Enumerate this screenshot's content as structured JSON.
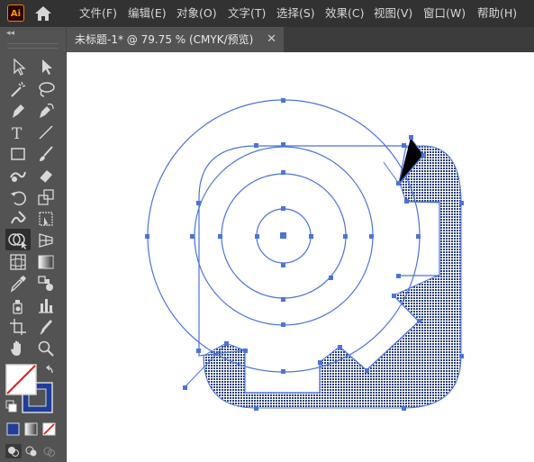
{
  "app": {
    "logo": "Ai"
  },
  "menus": [
    "文件(F)",
    "编辑(E)",
    "对象(O)",
    "文字(T)",
    "选择(S)",
    "效果(C)",
    "视图(V)",
    "窗口(W)",
    "帮助(H)"
  ],
  "document_tab": {
    "title": "未标题-1* @ 79.75 % (CMYK/预览)",
    "close": "✕"
  },
  "toolbar": {
    "collapse": "◂◂",
    "tools": [
      "selection-tool",
      "direct-selection-tool",
      "magic-wand-tool",
      "lasso-tool",
      "pen-tool",
      "curvature-tool",
      "type-tool",
      "line-tool",
      "rectangle-tool",
      "paintbrush-tool",
      "shaper-tool",
      "eraser-tool",
      "rotate-tool",
      "scale-tool",
      "warp-tool",
      "free-transform-tool",
      "shape-builder-tool",
      "perspective-grid-tool",
      "mesh-tool",
      "gradient-tool",
      "eyedropper-tool",
      "blend-tool",
      "symbol-sprayer-tool",
      "column-graph-tool",
      "artboard-tool",
      "slice-tool",
      "hand-tool",
      "zoom-tool"
    ]
  },
  "colors": {
    "menubar": "#323232",
    "panel": "#535353",
    "accent": "#4a74d9",
    "fill_pattern": "#2a3f7a",
    "stroke_swatch": "#1f3d99"
  }
}
